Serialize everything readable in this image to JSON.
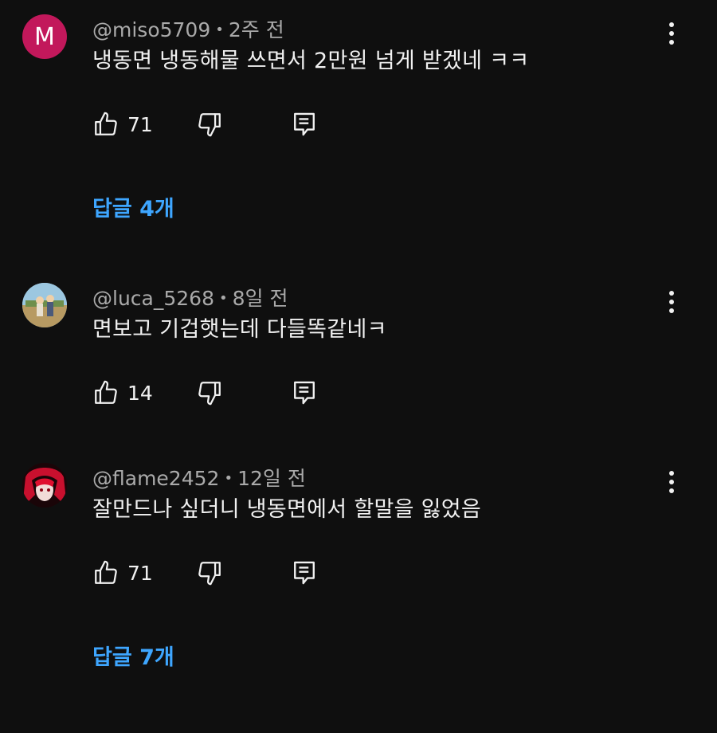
{
  "comments": [
    {
      "avatar_letter": "M",
      "avatar_color": "#c2185b",
      "author": "@miso5709",
      "separator": "•",
      "time": "2주 전",
      "text": "냉동면 냉동해물 쓰면서 2만원 넘게 받겠네 ㅋㅋ",
      "likes": "71",
      "replies": "답글 4개"
    },
    {
      "author": "@luca_5268",
      "separator": "•",
      "time": "8일 전",
      "text": "면보고 기겁햇는데 다들똑같네ㅋ",
      "likes": "14"
    },
    {
      "author": "@flame2452",
      "separator": "•",
      "time": "12일 전",
      "text": "잘만드나 싶더니 냉동면에서 할말을 잃었음",
      "likes": "71",
      "replies": "답글 7개"
    }
  ],
  "icons": {
    "like": "thumb-up-icon",
    "dislike": "thumb-down-icon",
    "reply": "comment-reply-icon",
    "menu": "more-vertical-icon"
  },
  "colors": {
    "background": "#0f0f0f",
    "text": "#f1f1f1",
    "meta": "#aaaaaa",
    "link": "#3ea6ff"
  }
}
